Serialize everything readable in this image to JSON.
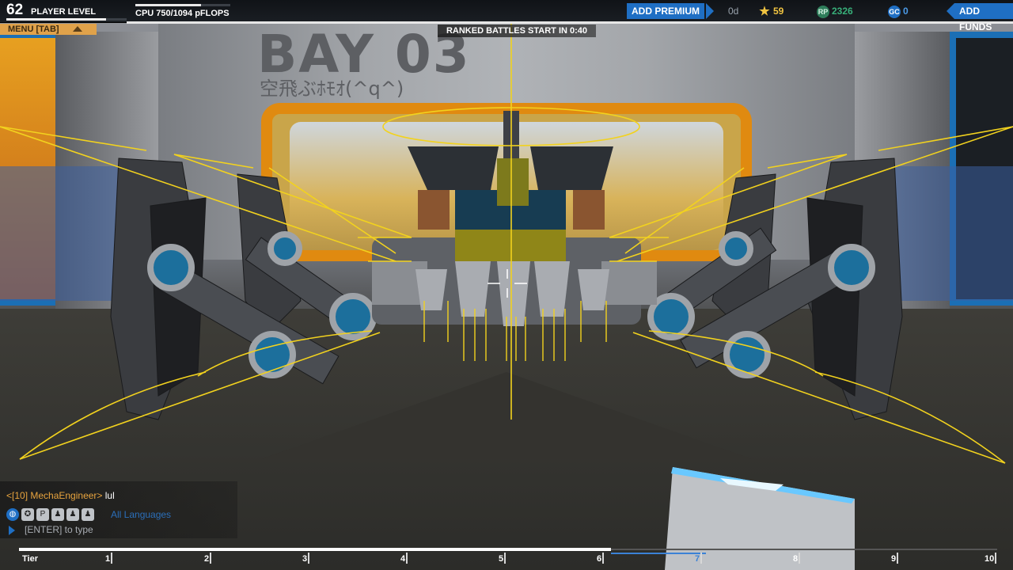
{
  "topbar": {
    "player_level": "62",
    "player_level_label": "PLAYER LEVEL",
    "level_progress": 0.83,
    "cpu_label": "CPU 750/1094 pFLOPS",
    "cpu_fraction": 0.69,
    "add_premium_label": "ADD PREMIUM",
    "premium_days": "0d",
    "stars": "59",
    "robits": "2326",
    "galaxy_coins": "0",
    "add_funds_label": "ADD FUNDS",
    "robits_icon": "RP",
    "galaxy_icon": "GC"
  },
  "menu": {
    "label": "MENU [TAB]"
  },
  "ranked": {
    "label": "RANKED BATTLES START IN 0:40"
  },
  "bay": {
    "title": "BAY 03",
    "subtitle": "空飛ぶﾎﾓｵ(^q^)"
  },
  "chat": {
    "sender": "<[10] MechaEngineer>",
    "message": "lul",
    "language": "All Languages",
    "placeholder": "[ENTER] to type",
    "icons": [
      "globe-icon",
      "clan-icon",
      "party-icon",
      "friend-icon",
      "friends-icon",
      "group-icon"
    ]
  },
  "tiers": {
    "label": "Tier",
    "labels": [
      "1",
      "2",
      "3",
      "4",
      "5",
      "6",
      "7",
      "8",
      "9",
      "10"
    ],
    "selected": "7"
  },
  "colors": {
    "accent_blue": "#1f6fc4",
    "force_lines": "#f2d21e",
    "menu_orange": "#e0a24a",
    "chat_sender": "#e8a43e"
  }
}
